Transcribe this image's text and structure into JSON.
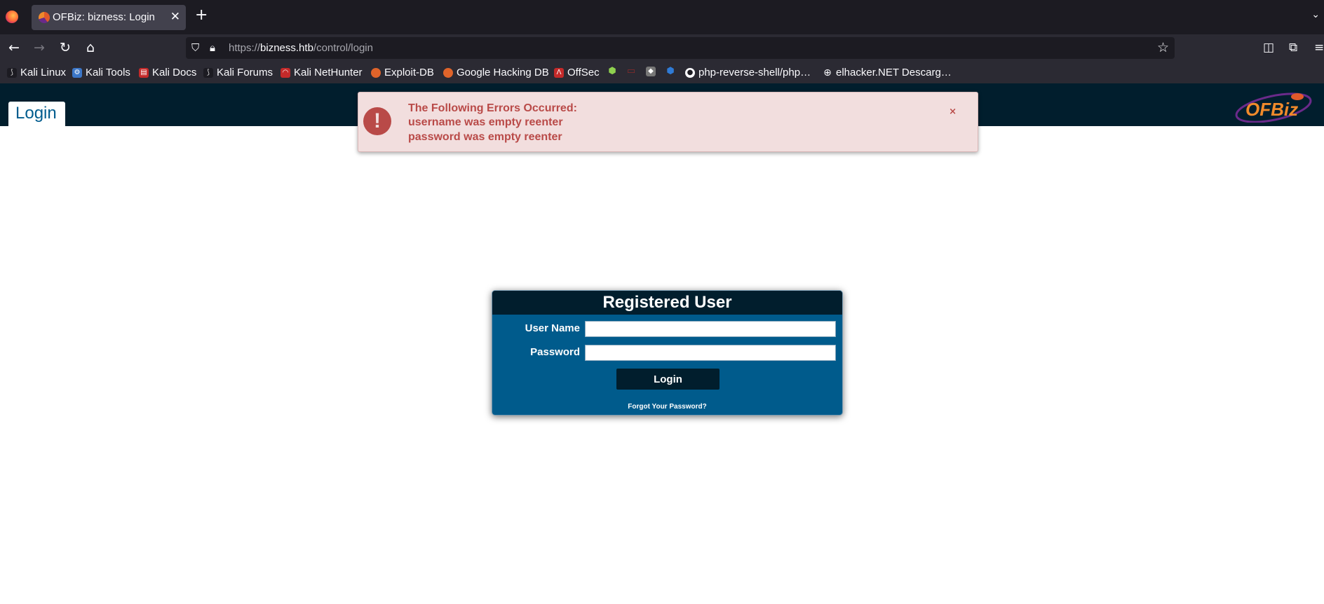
{
  "browser": {
    "tab_title": "OFBiz: bizness: Login",
    "tab_close_glyph": "✕",
    "new_tab_glyph": "+",
    "url_scheme": "https://",
    "url_host": "bizness.htb",
    "url_path": "/control/login",
    "bookmarks": [
      {
        "label": "Kali Linux",
        "icon": "kali-dragon-icon"
      },
      {
        "label": "Kali Tools",
        "icon": "kali-tools-icon"
      },
      {
        "label": "Kali Docs",
        "icon": "kali-docs-icon"
      },
      {
        "label": "Kali Forums",
        "icon": "kali-forums-icon"
      },
      {
        "label": "Kali NetHunter",
        "icon": "kali-nethunter-icon"
      },
      {
        "label": "Exploit-DB",
        "icon": "exploit-db-icon"
      },
      {
        "label": "Google Hacking DB",
        "icon": "ghdb-icon"
      },
      {
        "label": "OffSec",
        "icon": "offsec-icon"
      },
      {
        "label": "",
        "icon": "green-cube-icon"
      },
      {
        "label": "",
        "icon": "red-chat-icon"
      },
      {
        "label": "",
        "icon": "cat-icon"
      },
      {
        "label": "",
        "icon": "blue-cube-icon"
      },
      {
        "label": "php-reverse-shell/php…",
        "icon": "github-icon"
      },
      {
        "label": "elhacker.NET Descarg…",
        "icon": "globe-icon"
      }
    ]
  },
  "page": {
    "header_tab_label": "Login",
    "logo_text": "OFBiz",
    "error": {
      "title": "The Following Errors Occurred:",
      "messages": [
        "username was empty reenter",
        "password was empty reenter"
      ],
      "icon_glyph": "!",
      "close_glyph": "×"
    },
    "login_form": {
      "title": "Registered User",
      "username_label": "User Name",
      "password_label": "Password",
      "username_value": "",
      "password_value": "",
      "submit_label": "Login",
      "forgot_link": "Forgot Your Password?"
    }
  },
  "colors": {
    "header_bg": "#011e2d",
    "form_bg": "#005b8c",
    "error_bg": "#f2dede",
    "error_text": "#b94a48",
    "tab_label": "#005c8e"
  }
}
